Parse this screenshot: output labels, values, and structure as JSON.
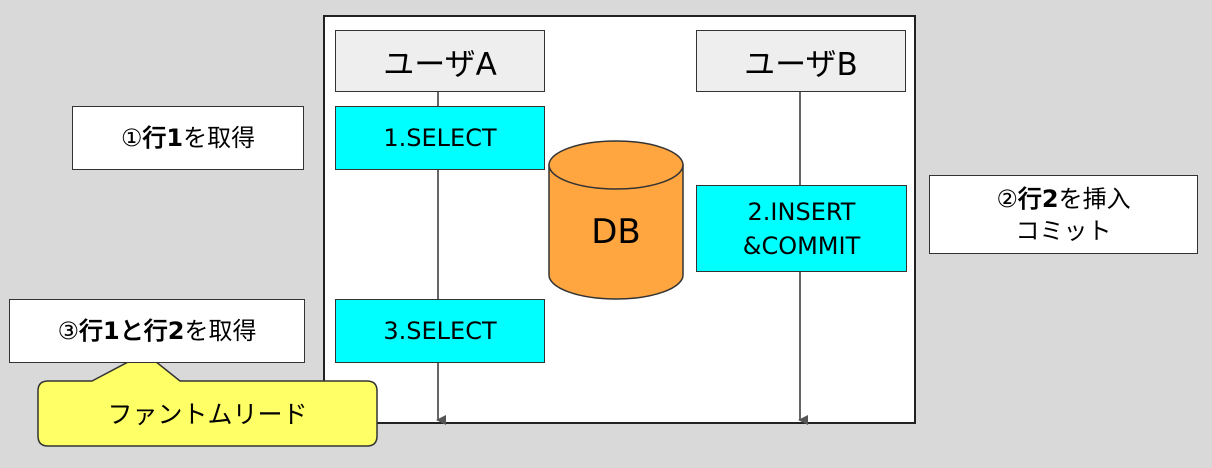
{
  "actors": {
    "a": "ユーザA",
    "b": "ユーザB"
  },
  "steps": {
    "select1": "1.SELECT",
    "insert_line1": "2.INSERT",
    "insert_line2": "&COMMIT",
    "select3": "3.SELECT"
  },
  "db_label": "DB",
  "notes": {
    "n1": {
      "mark": "①",
      "bold": "行1",
      "rest": "を取得"
    },
    "n2": {
      "mark": "②",
      "bold": "行2",
      "rest": "を挿入",
      "line2": "コミット"
    },
    "n3": {
      "mark": "③",
      "bold": "行1と行2",
      "rest": "を取得"
    }
  },
  "callout": "ファントムリード",
  "colors": {
    "step": "#00ffff",
    "db": "#ffa640",
    "callout": "#ffff66",
    "actor": "#eeeeee"
  }
}
